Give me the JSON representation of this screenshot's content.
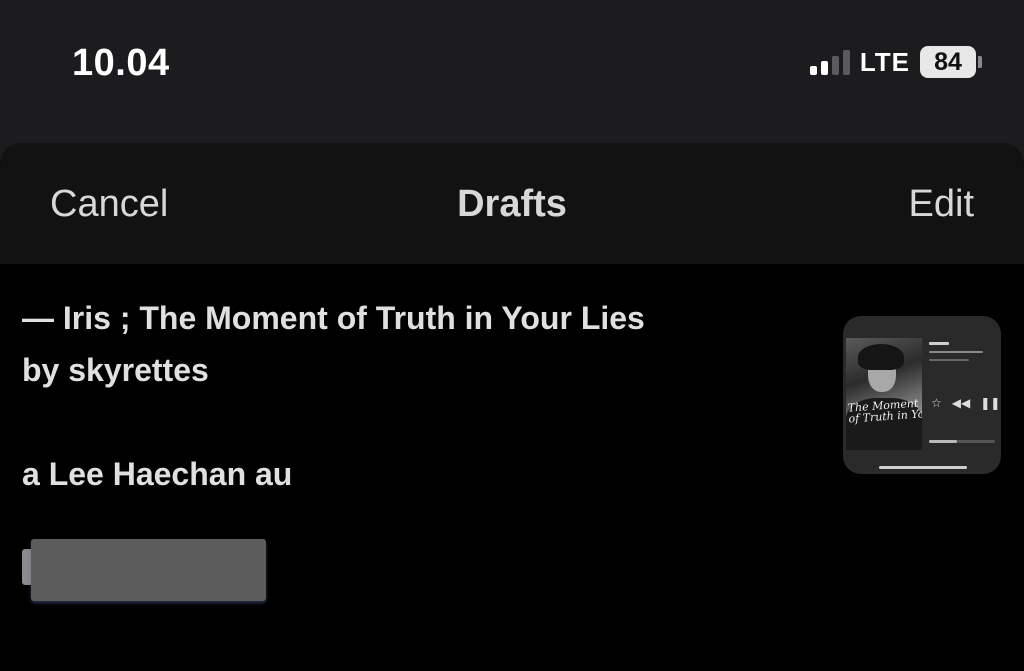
{
  "status_bar": {
    "time": "10.04",
    "network": "LTE",
    "battery": "84",
    "signal_icon": "cellular-signal-icon",
    "signal_bars_active": 2,
    "signal_bars_total": 4
  },
  "nav": {
    "cancel_label": "Cancel",
    "title": "Drafts",
    "edit_label": "Edit"
  },
  "draft": {
    "line1": "— Iris ; The Moment of Truth in Your Lies",
    "line2": "by skyrettes",
    "line3": "a Lee Haechan au",
    "thumbnail": {
      "cover_title_line1": "The Moment",
      "cover_title_line2": "of Truth in Your Lies",
      "track_label": "Iris",
      "icons": [
        "star-icon",
        "rewind-icon",
        "pause-icon"
      ]
    }
  },
  "colors": {
    "background": "#000000",
    "status_bar_bg": "#1c1c1e",
    "nav_bg": "#121212",
    "text": "#e0e0e0",
    "redaction": "#5c5c5c"
  }
}
